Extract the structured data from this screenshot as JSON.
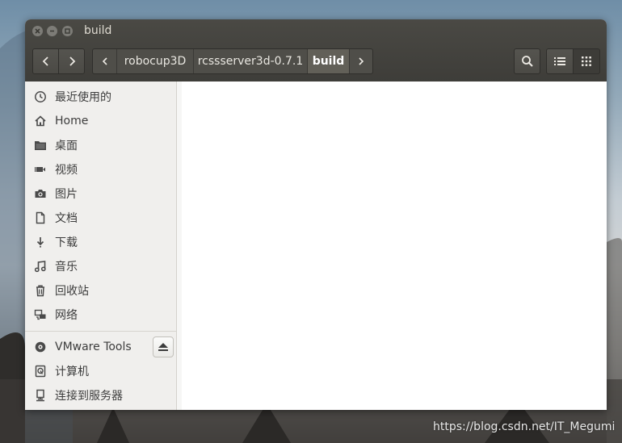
{
  "window": {
    "title": "build"
  },
  "toolbar": {
    "back_label": "‹",
    "forward_label": "›",
    "crumb_left_label": "‹",
    "crumb_right_label": "›"
  },
  "breadcrumb": {
    "items": [
      {
        "label": "robocup3D"
      },
      {
        "label": "rcssserver3d-0.7.1"
      },
      {
        "label": "build",
        "active": true
      }
    ]
  },
  "sidebar": {
    "items": [
      {
        "icon": "clock-icon",
        "label": "最近使用的"
      },
      {
        "icon": "home-icon",
        "label": "Home"
      },
      {
        "icon": "folder-icon",
        "label": "桌面"
      },
      {
        "icon": "video-icon",
        "label": "视频"
      },
      {
        "icon": "camera-icon",
        "label": "图片"
      },
      {
        "icon": "document-icon",
        "label": "文档"
      },
      {
        "icon": "download-icon",
        "label": "下载"
      },
      {
        "icon": "music-icon",
        "label": "音乐"
      },
      {
        "icon": "trash-icon",
        "label": "回收站"
      },
      {
        "icon": "network-icon",
        "label": "网络"
      }
    ],
    "devices": [
      {
        "icon": "disc-icon",
        "label": "VMware Tools"
      },
      {
        "icon": "computer-icon",
        "label": "计算机"
      },
      {
        "icon": "server-icon",
        "label": "连接到服务器"
      }
    ]
  },
  "watermark": "https://blog.csdn.net/IT_Megumi",
  "colors": {
    "titlebar": "#3e3d39",
    "sidebar": "#f0efed",
    "content": "#ffffff"
  }
}
